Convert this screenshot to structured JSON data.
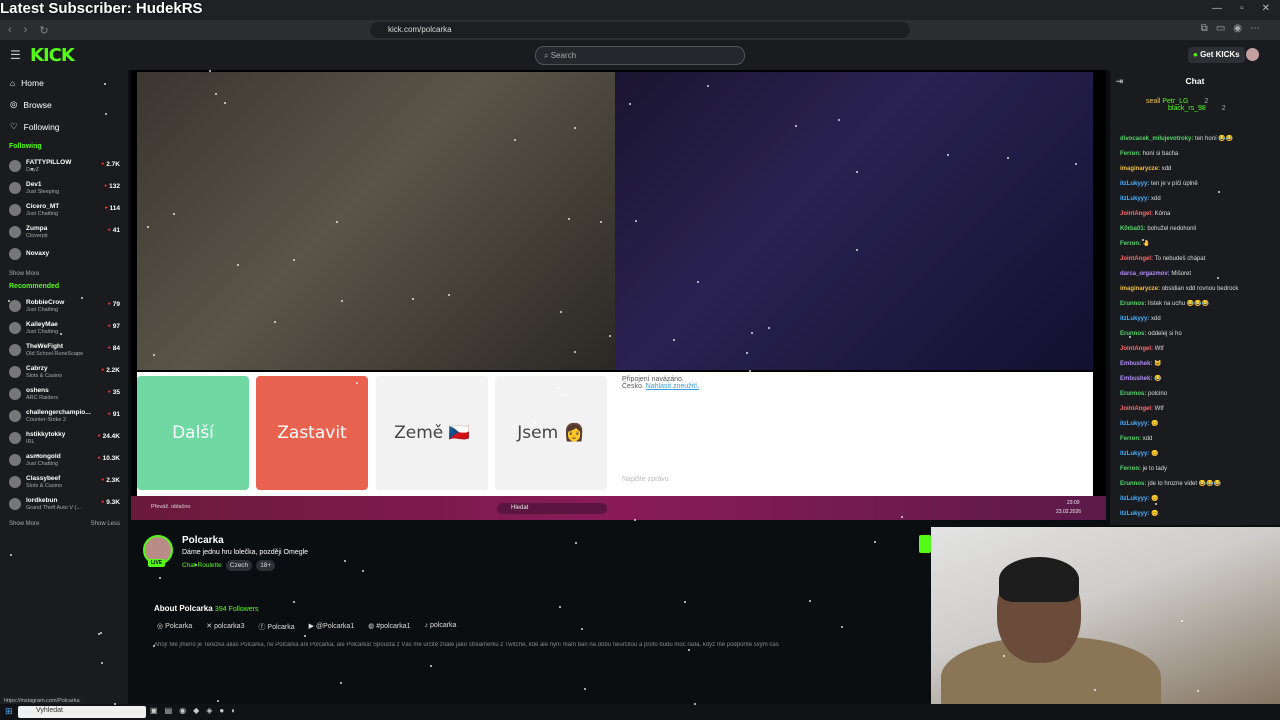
{
  "overlay": {
    "title": "Latest Subscriber: HudekRS"
  },
  "browser": {
    "url": "kick.com/polcarka"
  },
  "header": {
    "logo": "KICK",
    "search_placeholder": "Search",
    "get_kicks": "Get KICKs"
  },
  "sidebar": {
    "nav": [
      {
        "label": "Home",
        "icon": "home-icon"
      },
      {
        "label": "Browse",
        "icon": "compass-icon"
      },
      {
        "label": "Following",
        "icon": "heart-icon"
      }
    ],
    "following_title": "Following",
    "following": [
      {
        "name": "FATTYPILLOW",
        "sub": "DayZ",
        "viewers": "2.7K"
      },
      {
        "name": "Dev1",
        "sub": "Just Sleeping",
        "viewers": "132"
      },
      {
        "name": "Cicero_MT",
        "sub": "Just Chatting",
        "viewers": "114"
      },
      {
        "name": "Zumpa",
        "sub": "Cloverpit",
        "viewers": "41"
      },
      {
        "name": "Novaxy",
        "sub": "",
        "viewers": ""
      }
    ],
    "show_more_1": "Show More",
    "recommended_title": "Recommended",
    "recommended": [
      {
        "name": "RobbieCrow",
        "sub": "Just Chatting",
        "viewers": "79"
      },
      {
        "name": "KaileyMae",
        "sub": "Just Chatting",
        "viewers": "97"
      },
      {
        "name": "TheWeFight",
        "sub": "Old School RuneScape",
        "viewers": "84"
      },
      {
        "name": "Cabrzy",
        "sub": "Slots & Casino",
        "viewers": "2.2K"
      },
      {
        "name": "oshens",
        "sub": "ARC Raiders",
        "viewers": "35"
      },
      {
        "name": "challengerchampio...",
        "sub": "Counter-Strike 2",
        "viewers": "91"
      },
      {
        "name": "hstikkytokky",
        "sub": "IRL",
        "viewers": "24.4K"
      },
      {
        "name": "asmongold",
        "sub": "Just Chatting",
        "viewers": "10.3K"
      },
      {
        "name": "Classybeef",
        "sub": "Slots & Casino",
        "viewers": "2.3K"
      },
      {
        "name": "lordkebun",
        "sub": "Grand Theft Auto V (...",
        "viewers": "9.3K"
      }
    ],
    "show_more_2": "Show More",
    "show_less": "Show Less"
  },
  "player": {
    "buttons": [
      {
        "label": "Další",
        "bg": "#6fd8a3",
        "color": "#ffffff"
      },
      {
        "label": "Zastavit",
        "bg": "#e8624f",
        "color": "#ffffff"
      },
      {
        "label": "Země 🇨🇿",
        "bg": "#f2f2f2",
        "color": "#444444"
      },
      {
        "label": "Jsem 👩",
        "bg": "#f2f2f2",
        "color": "#444444"
      }
    ],
    "notice": "Připojení navázáno.",
    "notice_country": "Česko.",
    "notice_report": "Nahlásit zneužití.",
    "message_placeholder": "Napište zprávu",
    "taskbar_weather": "Převáž. oblačno",
    "taskbar_search": "Hledat",
    "taskbar_time": "23:09",
    "taskbar_date": "23.02.2026"
  },
  "chat": {
    "title": "Chat",
    "leaders": [
      "Petr_LG",
      "black_rs_98"
    ],
    "leader_counts": [
      "2",
      "2"
    ],
    "leader_first": "seall",
    "messages": [
      {
        "user": "divocacek_milujevotroky:",
        "text": "ten honí 😂😂",
        "color": "#53d769"
      },
      {
        "user": "Ferron:",
        "text": "honí si bacha",
        "color": "#53d769"
      },
      {
        "user": "imaginaryczе:",
        "text": "xdd",
        "color": "#f0c040"
      },
      {
        "user": "itzLukyyy:",
        "text": "ten je v píči úplně",
        "color": "#4ab0ff"
      },
      {
        "user": "itzLukyyy:",
        "text": "xdd",
        "color": "#4ab0ff"
      },
      {
        "user": "JointAngel:",
        "text": "Kóma",
        "color": "#ff6b6b"
      },
      {
        "user": "K0rba01:",
        "text": "bohužel nedohonil",
        "color": "#53d769"
      },
      {
        "user": "Ferron:",
        "text": "🤚",
        "color": "#53d769"
      },
      {
        "user": "JointAngel:",
        "text": "To nebudeš chápat",
        "color": "#ff6b6b"
      },
      {
        "user": "darca_orgazmov:",
        "text": "Mišoret",
        "color": "#b58cff"
      },
      {
        "user": "imaginaryczе:",
        "text": "obsidian xdd rovnou bedrock",
        "color": "#f0c040"
      },
      {
        "user": "Erunnos:",
        "text": "lístek na uchu 😂😂😂",
        "color": "#53d769"
      },
      {
        "user": "itzLukyyy:",
        "text": "xdd",
        "color": "#4ab0ff"
      },
      {
        "user": "Erunnos:",
        "text": "oddelej si ho",
        "color": "#53d769"
      },
      {
        "user": "JointAngel:",
        "text": "Wtf",
        "color": "#ff6b6b"
      },
      {
        "user": "Embushek:",
        "text": "🐱",
        "color": "#b58cff"
      },
      {
        "user": "Embushek:",
        "text": "😂",
        "color": "#b58cff"
      },
      {
        "user": "Erunnos:",
        "text": "polcino",
        "color": "#53d769"
      },
      {
        "user": "JointAngel:",
        "text": "Wtf",
        "color": "#ff6b6b"
      },
      {
        "user": "itzLukyyy:",
        "text": "😊",
        "color": "#4ab0ff"
      },
      {
        "user": "Ferron:",
        "text": "xdd",
        "color": "#53d769"
      },
      {
        "user": "itzLukyyy:",
        "text": "😊",
        "color": "#4ab0ff"
      },
      {
        "user": "Ferron:",
        "text": "je to tady",
        "color": "#53d769"
      },
      {
        "user": "Erunnos:",
        "text": "jde to hrozne videt 😂😂😂",
        "color": "#53d769"
      },
      {
        "user": "itzLukyyy:",
        "text": "😊",
        "color": "#4ab0ff"
      },
      {
        "user": "itzLukyyy:",
        "text": "😊",
        "color": "#4ab0ff"
      }
    ]
  },
  "channel": {
    "name": "Polcarka",
    "title": "Dáme jednu hru lolečka, později Omegle",
    "category": "Chat Roulette",
    "tags": [
      "Czech",
      "18+"
    ],
    "live": "LIVE",
    "about_label": "About Polcarka",
    "followers": "394 Followers",
    "socials": [
      {
        "icon": "instagram-icon",
        "label": "Polcarka"
      },
      {
        "icon": "x-icon",
        "label": "polcarka3"
      },
      {
        "icon": "facebook-icon",
        "label": "Polcarka"
      },
      {
        "icon": "youtube-icon",
        "label": "@Polcarka1"
      },
      {
        "icon": "discord-icon",
        "label": "#polcarka1"
      },
      {
        "icon": "tiktok-icon",
        "label": "polcarka"
      }
    ],
    "bio": "Ahoj! Mé jméno je Terezka alias Polcarka, ne Půlčárka ani Polcárka, ale Polcarka! Spousta z Vás mě určitě znáte jako streamerku z Twitche, kde ale nyní mám ban na dobu neurčitou a proto budu moc ráda, když mě podpoříte svým čas"
  },
  "status": {
    "url": "https://instagram.com/Polcarka"
  },
  "windows": {
    "search": "Vyhledat"
  }
}
